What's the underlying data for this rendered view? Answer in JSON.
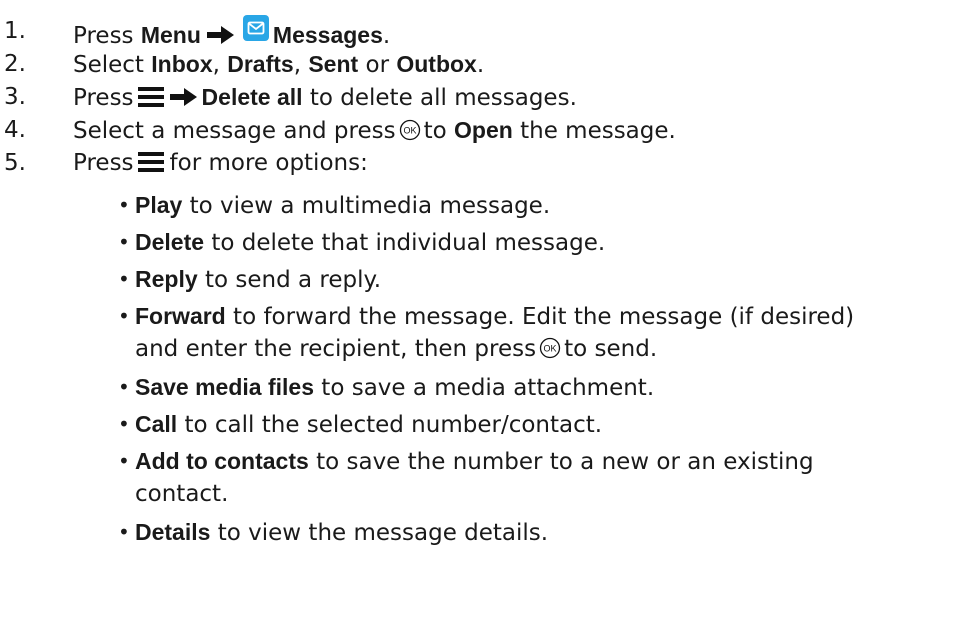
{
  "steps": [
    {
      "num": "1.",
      "press": "Press",
      "menu": "Menu",
      "messages": "Messages",
      "end": "."
    },
    {
      "num": "2.",
      "select": "Select",
      "inbox": "Inbox",
      "sep1": ",",
      "drafts": "Drafts",
      "sep2": ",",
      "sent": "Sent",
      "or": "or",
      "outbox": "Outbox",
      "end": "."
    },
    {
      "num": "3.",
      "press": "Press",
      "delete_all": "Delete all",
      "rest": "to delete all messages."
    },
    {
      "num": "4.",
      "pre": "Select a message and press",
      "to": "to",
      "open": "Open",
      "rest": "the message."
    },
    {
      "num": "5.",
      "press": "Press",
      "rest": "for more options:"
    }
  ],
  "options": [
    {
      "bullet": "•",
      "bold": "Play",
      "rest": " to view a multimedia message."
    },
    {
      "bullet": "•",
      "bold": "Delete",
      "rest": " to delete that individual message."
    },
    {
      "bullet": "•",
      "bold": "Reply",
      "rest": " to send a reply."
    },
    {
      "bullet": "•",
      "bold": "Forward",
      "rest": " to forward the message. Edit the message (if desired)",
      "line2_pre": "and enter the recipient, then press",
      "line2_post": "to send."
    },
    {
      "bullet": "•",
      "bold": "Save media files",
      "rest": " to save a media attachment."
    },
    {
      "bullet": "•",
      "bold": "Call",
      "rest": " to call the selected number/contact."
    },
    {
      "bullet": "•",
      "bold": "Add to contacts",
      "rest": " to save the number to a new or an existing",
      "line2": "contact."
    },
    {
      "bullet": "•",
      "bold": "Details",
      "rest": " to view the message details."
    }
  ],
  "icons": {
    "messages_icon": "envelope-app-icon",
    "messages_icon_color": "#29a6e6",
    "menu_icon": "hamburger-menu-icon",
    "arrow_icon": "right-arrow-icon",
    "ok_icon": "ok-key-icon"
  }
}
